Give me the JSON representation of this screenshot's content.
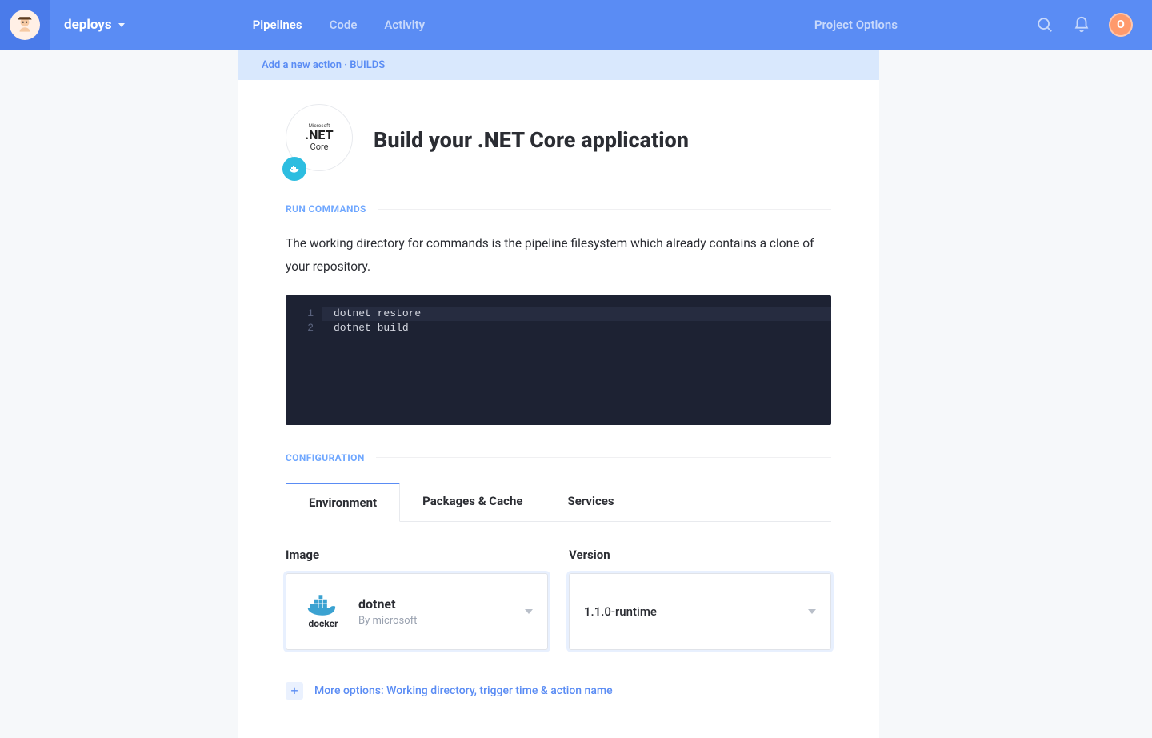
{
  "topbar": {
    "project_name": "deploys",
    "tabs": [
      "Pipelines",
      "Code",
      "Activity"
    ],
    "active_tab_index": 0,
    "project_options_label": "Project Options",
    "avatar_initial": "O"
  },
  "breadcrumb": "Add a new action · BUILDS",
  "header": {
    "icon_lines": {
      "top": "Microsoft",
      "mid": ".NET",
      "bot": "Core"
    },
    "title": "Build your .NET Core application"
  },
  "run_commands": {
    "section": "RUN COMMANDS",
    "description": "The working directory for commands is the pipeline filesystem which already contains a clone of your repository.",
    "lines": [
      "dotnet restore",
      "dotnet build"
    ]
  },
  "configuration": {
    "section": "CONFIGURATION",
    "tabs": [
      "Environment",
      "Packages & Cache",
      "Services"
    ],
    "active_tab_index": 0,
    "image_field": {
      "label": "Image",
      "value": "dotnet",
      "subtitle": "By microsoft",
      "logo_text": "docker"
    },
    "version_field": {
      "label": "Version",
      "value": "1.1.0-runtime"
    }
  },
  "more_options": "More options: Working directory, trigger time & action name"
}
